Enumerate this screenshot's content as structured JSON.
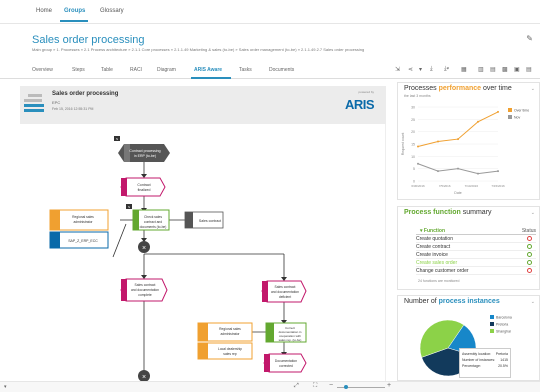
{
  "nav": {
    "home": "Home",
    "groups": "Groups",
    "glossary": "Glossary"
  },
  "page": {
    "title": "Sales order processing",
    "breadcrumb": "Main group » 1. Processes » 2.1 Process architecture » 2.1.1 Core processes » 2.1.1.49 Marketing & sales (to-be) » Sales order management (to-be) » 2.1.1.49.2.7 Sales order processing"
  },
  "tabs": [
    "Overview",
    "Steps",
    "Table",
    "RACI",
    "Diagram",
    "ARIS Aware",
    "Tasks",
    "Documents"
  ],
  "active_tab": "ARIS Aware",
  "sheet": {
    "title": "Sales order processing",
    "subtitle": "EPC",
    "date": "Feb 15, 2016 12:55:31 PM",
    "powered": "powered by",
    "brand": "ARIS"
  },
  "diagram": {
    "nodes": {
      "event1": "Contract processing in ERP (to-be)",
      "event2": "Contract finalized",
      "func1": "Check sales contract and documents (to-be)",
      "doc1": "Sales contract",
      "role1": "Regional sales administrator",
      "sys1": "SAP_Z_ERP_ECC",
      "event3": "Sales contract and documentation complete",
      "event4": "Sales contract and documentation deficient",
      "func2": "Correct documentation in cooperation with sales rep. (to-be)",
      "role2": "Regional sales administrator",
      "role3": "Local dealership sales rep",
      "event5": "Documentation corrected"
    }
  },
  "perf": {
    "title_a": "Processes ",
    "title_b": "performance",
    "title_c": " over time",
    "subtitle": "the last 3 months",
    "legend": [
      "Over time",
      "Nov"
    ],
    "xlabels": [
      "6/30/2016",
      "7/5/2016",
      "7/10/2016",
      "7/15/2016"
    ],
    "xaxis": "Date",
    "yaxis": "Request count",
    "yticks": [
      "30",
      "25",
      "20",
      "15",
      "10",
      "5",
      "0"
    ],
    "colors": {
      "over_time": "#f0a030",
      "nov": "#999999"
    }
  },
  "chart_data": [
    {
      "type": "line",
      "title": "Processes performance over time",
      "subtitle": "the last 3 months",
      "xlabel": "Date",
      "ylabel": "Request count",
      "x": [
        "6/30/2016",
        "7/5/2016",
        "7/10/2016",
        "7/15/2016"
      ],
      "ylim": [
        0,
        30
      ],
      "series": [
        {
          "name": "Over time",
          "values": [
            14,
            16,
            17,
            24,
            28
          ]
        },
        {
          "name": "Nov",
          "values": [
            7,
            4,
            5,
            3,
            4
          ]
        }
      ]
    },
    {
      "type": "pie",
      "title": "Number of process instances",
      "categories": [
        "Barcelona",
        "Pretoria",
        "Shanghai"
      ],
      "values": [
        20,
        40,
        40
      ]
    }
  ],
  "func": {
    "title_a": "Process function",
    "title_b": " summary",
    "col_function": "Function",
    "col_status": "Status",
    "rows": [
      {
        "name": "Create quotation",
        "status": "red"
      },
      {
        "name": "Create contract",
        "status": "green"
      },
      {
        "name": "Create invoice",
        "status": "green"
      },
      {
        "name": "Create sales order",
        "status": "green"
      },
      {
        "name": "Change customer order",
        "status": "red"
      }
    ],
    "footer": "24 functions are monitored"
  },
  "inst": {
    "title_a": "Number of ",
    "title_b": "process instances",
    "legend": [
      "Barcelona",
      "Pretoria",
      "Shanghai"
    ],
    "tooltip": {
      "k1": "Assembly location:",
      "v1": "Pretoria",
      "k2": "Number of instances:",
      "v2": "1415",
      "k3": "Percentage:",
      "v3": "20.5%"
    }
  },
  "zoom": {
    "minus": "−",
    "plus": "+"
  }
}
